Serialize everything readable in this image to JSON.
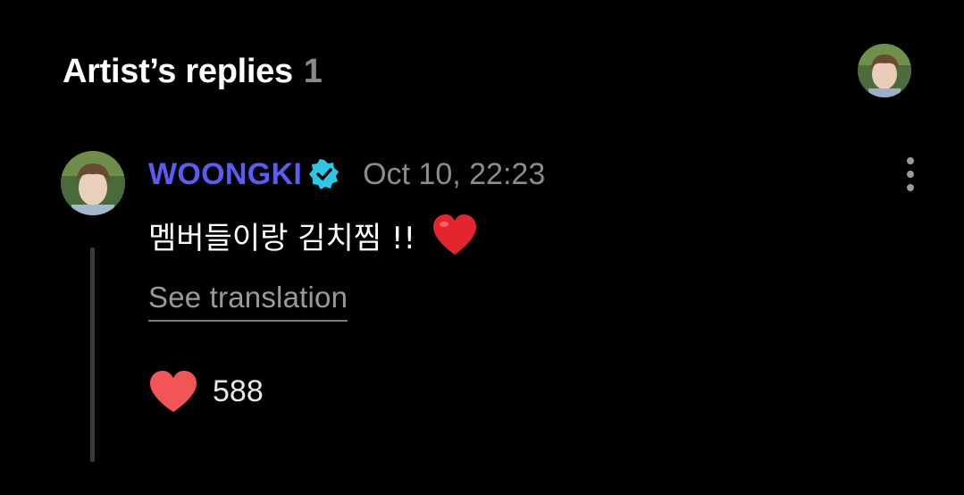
{
  "header": {
    "title": "Artist’s replies",
    "count": "1"
  },
  "comment": {
    "username": "WOONGKI",
    "timestamp": "Oct 10, 22:23",
    "message": "멤버들이랑 김치찜 !!",
    "message_emoji": "heart-emoji",
    "translate_link": "See translation",
    "like_count": "588"
  },
  "colors": {
    "background": "#000000",
    "username": "#5b5cf6",
    "verified_badge": "#2ec6e6",
    "heart": "#f25555",
    "muted_text": "#8c8c8c"
  },
  "icons": {
    "verified": "verified-badge-icon",
    "more": "more-vertical-icon",
    "like": "heart-icon"
  }
}
